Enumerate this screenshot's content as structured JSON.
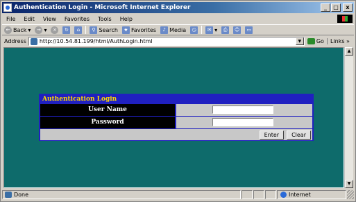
{
  "window": {
    "title": "Authentication Login - Microsoft Internet Explorer",
    "min": "_",
    "max": "□",
    "close": "x"
  },
  "menu": [
    "File",
    "Edit",
    "View",
    "Favorites",
    "Tools",
    "Help"
  ],
  "toolbar": {
    "back": "Back",
    "search": "Search",
    "favorites": "Favorites",
    "media": "Media"
  },
  "address": {
    "label": "Address",
    "url": "http://10.54.81.199/html/AuthLogin.html",
    "go": "Go",
    "links": "Links »"
  },
  "login": {
    "title": "Authentication Login",
    "username_label": "User Name",
    "password_label": "Password",
    "username_value": "",
    "password_value": "",
    "enter": "Enter",
    "clear": "Clear"
  },
  "status": {
    "text": "Done",
    "zone": "Internet"
  },
  "colors": {
    "page_bg": "#0e6b6b",
    "panel": "#2020c0",
    "panel_title": "#ffd700"
  }
}
